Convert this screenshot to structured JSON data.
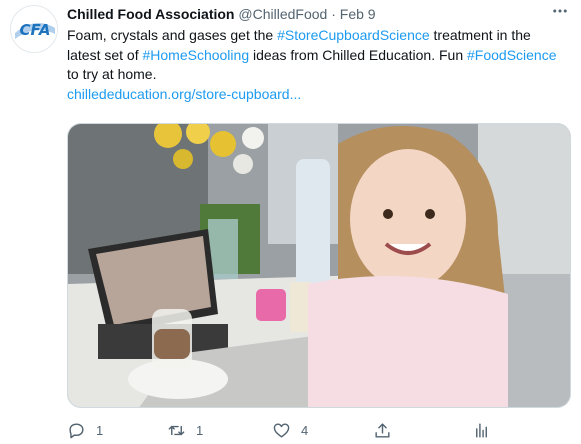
{
  "author": {
    "name": "Chilled Food Association",
    "handle": "@ChilledFood",
    "separator": "·",
    "date": "Feb 9",
    "avatar_text": "CFA"
  },
  "tweet": {
    "t1": "Foam, crystals and gases get the ",
    "h1": "#StoreCupboardScience",
    "t2": " treatment in the latest set of ",
    "h2": "#HomeSchooling",
    "t3": " ideas from Chilled Education. Fun ",
    "h3": "#FoodScience",
    "t4": " to try at home.",
    "link": "chillededucation.org/store-cupboard..."
  },
  "actions": {
    "reply_count": "1",
    "retweet_count": "1",
    "like_count": "4"
  },
  "colors": {
    "link": "#1d9bf0",
    "secondary_text": "#536471",
    "primary_text": "#0f1419",
    "avatar_blue": "#1e73be"
  },
  "icons": [
    "more-icon",
    "reply-icon",
    "retweet-icon",
    "like-icon",
    "share-icon",
    "analytics-icon"
  ]
}
